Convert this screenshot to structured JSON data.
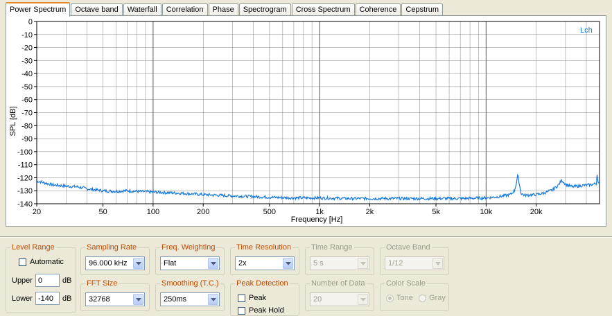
{
  "tabs": [
    "Power Spectrum",
    "Octave band",
    "Waterfall",
    "Correlation",
    "Phase",
    "Spectrogram",
    "Cross Spectrum",
    "Coherence",
    "Cepstrum"
  ],
  "colors": {
    "trace": "#1478dc",
    "grid": "#808080",
    "label_orange": "#c04a00",
    "legend": "#1478dc"
  },
  "chart_data": {
    "type": "line",
    "xlabel": "Frequency [Hz]",
    "ylabel": "SPL [dB]",
    "x_scale": "log",
    "xlim": [
      20,
      48000
    ],
    "ylim": [
      -140,
      0
    ],
    "grid": true,
    "legend_position": "top-right",
    "x_tick_labels": [
      {
        "v": 20,
        "t": "20"
      },
      {
        "v": 50,
        "t": "50"
      },
      {
        "v": 100,
        "t": "100"
      },
      {
        "v": 200,
        "t": "200"
      },
      {
        "v": 500,
        "t": "500"
      },
      {
        "v": 1000,
        "t": "1k"
      },
      {
        "v": 2000,
        "t": "2k"
      },
      {
        "v": 5000,
        "t": "5k"
      },
      {
        "v": 10000,
        "t": "10k"
      },
      {
        "v": 20000,
        "t": "20k"
      }
    ],
    "y_ticks": [
      0,
      -10,
      -20,
      -30,
      -40,
      -50,
      -60,
      -70,
      -80,
      -90,
      -100,
      -110,
      -120,
      -130,
      -140
    ],
    "series": [
      {
        "name": "Lch",
        "color": "#1478dc",
        "points": [
          [
            20,
            -122.5
          ],
          [
            25,
            -125.5
          ],
          [
            30,
            -126.5
          ],
          [
            35,
            -127
          ],
          [
            40,
            -128.5
          ],
          [
            50,
            -130
          ],
          [
            60,
            -130.5
          ],
          [
            70,
            -130
          ],
          [
            80,
            -130.5
          ],
          [
            100,
            -131
          ],
          [
            120,
            -131.5
          ],
          [
            150,
            -132
          ],
          [
            200,
            -133
          ],
          [
            250,
            -133.5
          ],
          [
            300,
            -134
          ],
          [
            400,
            -134.5
          ],
          [
            500,
            -135
          ],
          [
            700,
            -135.5
          ],
          [
            1000,
            -135.5
          ],
          [
            1500,
            -136
          ],
          [
            2000,
            -136
          ],
          [
            3000,
            -136
          ],
          [
            5000,
            -136
          ],
          [
            7000,
            -136
          ],
          [
            10000,
            -135.5
          ],
          [
            12000,
            -134.5
          ],
          [
            14000,
            -133
          ],
          [
            14800,
            -130
          ],
          [
            15200,
            -124
          ],
          [
            15500,
            -118
          ],
          [
            15800,
            -124
          ],
          [
            16200,
            -132
          ],
          [
            17000,
            -133.5
          ],
          [
            20000,
            -133
          ],
          [
            22000,
            -132
          ],
          [
            25000,
            -129.5
          ],
          [
            27000,
            -126
          ],
          [
            28500,
            -122
          ],
          [
            30000,
            -125
          ],
          [
            33000,
            -127
          ],
          [
            38000,
            -126
          ],
          [
            42000,
            -125.5
          ],
          [
            46000,
            -124.5
          ],
          [
            46500,
            -115
          ],
          [
            47000,
            -124
          ],
          [
            48000,
            -125
          ]
        ]
      }
    ]
  },
  "controls": {
    "level_range": {
      "title": "Level Range",
      "automatic_label": "Automatic",
      "upper_label": "Upper",
      "upper_value": "0",
      "upper_unit": "dB",
      "lower_label": "Lower",
      "lower_value": "-140",
      "lower_unit": "dB"
    },
    "sampling_rate": {
      "title": "Sampling Rate",
      "value": "96.000 kHz"
    },
    "fft_size": {
      "title": "FFT Size",
      "value": "32768"
    },
    "freq_weighting": {
      "title": "Freq. Weighting",
      "value": "Flat"
    },
    "smoothing": {
      "title": "Smoothing (T.C.)",
      "value": "250ms"
    },
    "time_resolution": {
      "title": "Time Resolution",
      "value": "2x"
    },
    "peak_detection": {
      "title": "Peak Detection",
      "peak_label": "Peak",
      "peak_hold_label": "Peak Hold"
    },
    "time_range": {
      "title": "Time Range",
      "value": "5 s"
    },
    "number_of_data": {
      "title": "Number of Data",
      "value": "20"
    },
    "octave_band": {
      "title": "Octave Band",
      "value": "1/12"
    },
    "color_scale": {
      "title": "Color Scale",
      "tone_label": "Tone",
      "gray_label": "Gray"
    }
  }
}
